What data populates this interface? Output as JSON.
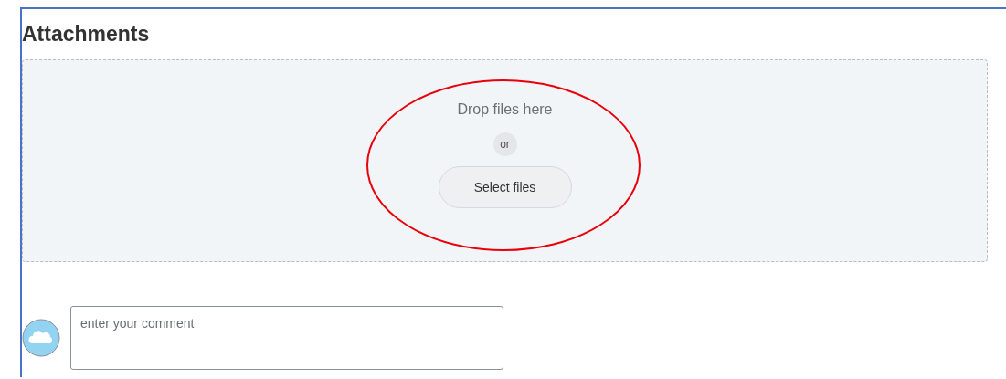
{
  "section": {
    "title": "Attachments"
  },
  "dropzone": {
    "prompt": "Drop files here",
    "separator": "or",
    "button": "Select files"
  },
  "comment": {
    "placeholder": "enter your comment"
  }
}
